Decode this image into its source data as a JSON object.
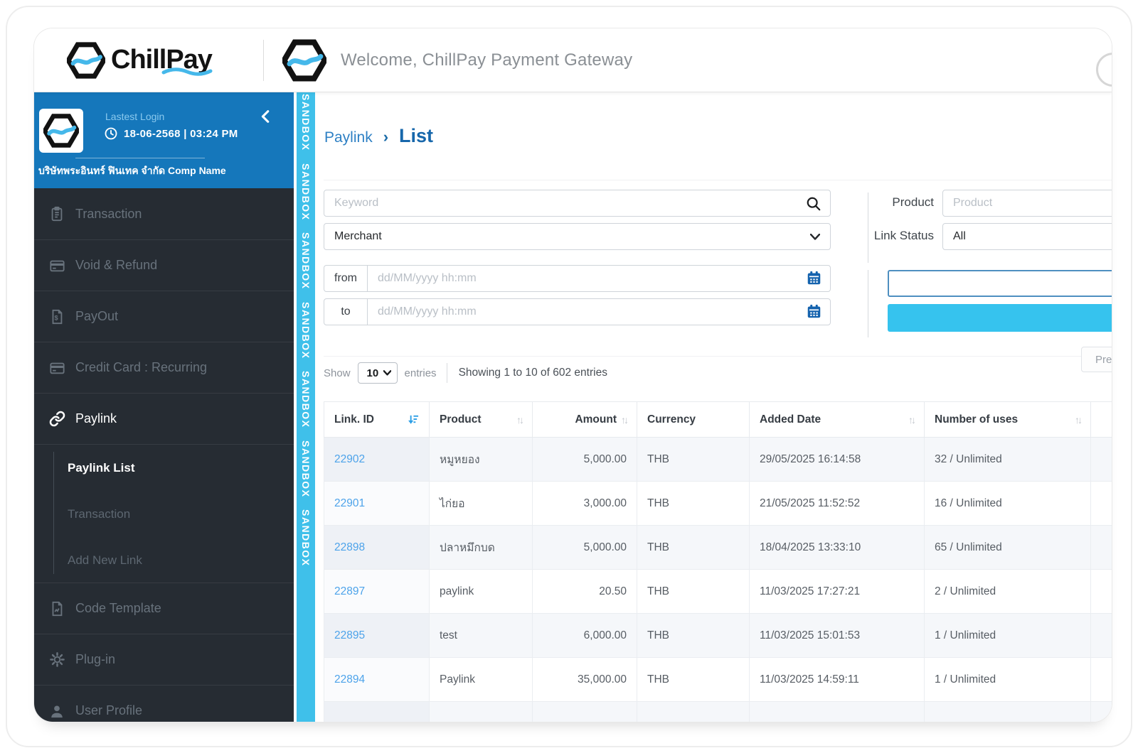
{
  "header": {
    "brand": "ChillPay",
    "welcome": "Welcome, ChillPay Payment Gateway"
  },
  "sandbox": {
    "label": "SANDBOX",
    "repeat": 7
  },
  "sidebar": {
    "panel": {
      "lastest_login_label": "Lastest Login",
      "login_datetime": "18-06-2568 | 03:24 PM",
      "company": "บริษัทพระอินทร์ ฟินเทค จำกัด Comp Name"
    },
    "menu_top": [
      {
        "label": "Transaction",
        "icon": "clipboard-icon",
        "active": false
      },
      {
        "label": "Void & Refund",
        "icon": "credit-card-icon",
        "active": false
      },
      {
        "label": "PayOut",
        "icon": "receipt-icon",
        "active": false
      },
      {
        "label": "Credit Card : Recurring",
        "icon": "credit-card-icon",
        "active": false
      },
      {
        "label": "Paylink",
        "icon": "link-icon",
        "active": true
      }
    ],
    "submenu": [
      {
        "label": "Paylink List",
        "active": true
      },
      {
        "label": "Transaction",
        "active": false
      },
      {
        "label": "Add New Link",
        "active": false
      }
    ],
    "menu_bottom": [
      {
        "label": "Code Template",
        "icon": "file-icon",
        "active": false
      },
      {
        "label": "Plug-in",
        "icon": "gear-icon",
        "active": false
      },
      {
        "label": "User Profile",
        "icon": "user-icon",
        "active": false
      }
    ]
  },
  "breadcrumb": {
    "parent": "Paylink",
    "separator": "›",
    "current": "List"
  },
  "filters": {
    "keyword_placeholder": "Keyword",
    "merchant_value": "Merchant",
    "from_label": "from",
    "to_label": "to",
    "date_placeholder": "dd/MM/yyyy hh:mm",
    "product_label": "Product",
    "product_placeholder": "Product",
    "link_status_label": "Link Status",
    "link_status_value": "All"
  },
  "list_controls": {
    "show_label": "Show",
    "page_size": "10",
    "entries_label": "entries",
    "showing_text": "Showing 1 to 10 of 602 entries",
    "prev_label": "Previous"
  },
  "table": {
    "columns": [
      {
        "label": "Link. ID",
        "sort": "active"
      },
      {
        "label": "Product",
        "sort": "both"
      },
      {
        "label": "Amount",
        "sort": "both",
        "align": "right"
      },
      {
        "label": "Currency",
        "sort": "none"
      },
      {
        "label": "Added Date",
        "sort": "both"
      },
      {
        "label": "Number of uses",
        "sort": "both"
      },
      {
        "label": "",
        "sort": "none"
      }
    ],
    "rows": [
      {
        "link_id": "22902",
        "product": "หมูหยอง",
        "amount": "5,000.00",
        "currency": "THB",
        "added_date": "29/05/2025 16:14:58",
        "uses": "32 / Unlimited"
      },
      {
        "link_id": "22901",
        "product": "ไก่ยอ",
        "amount": "3,000.00",
        "currency": "THB",
        "added_date": "21/05/2025 11:52:52",
        "uses": "16 / Unlimited"
      },
      {
        "link_id": "22898",
        "product": "ปลาหมึกบด",
        "amount": "5,000.00",
        "currency": "THB",
        "added_date": "18/04/2025 13:33:10",
        "uses": "65 / Unlimited"
      },
      {
        "link_id": "22897",
        "product": "paylink",
        "amount": "20.50",
        "currency": "THB",
        "added_date": "11/03/2025 17:27:21",
        "uses": "2 / Unlimited"
      },
      {
        "link_id": "22895",
        "product": "test",
        "amount": "6,000.00",
        "currency": "THB",
        "added_date": "11/03/2025 15:01:53",
        "uses": "1 / Unlimited"
      },
      {
        "link_id": "22894",
        "product": "Paylink",
        "amount": "35,000.00",
        "currency": "THB",
        "added_date": "11/03/2025 14:59:11",
        "uses": "1 / Unlimited"
      }
    ]
  },
  "colors": {
    "panel_blue": "#1577bb",
    "ribbon_blue": "#3fc0ea",
    "sidebar_dark": "#262c33",
    "link_blue": "#4da3ea",
    "accent_cyan": "#36c3ee",
    "breadcrumb_blue": "#1767ab",
    "calendar_blue": "#1563ae"
  }
}
